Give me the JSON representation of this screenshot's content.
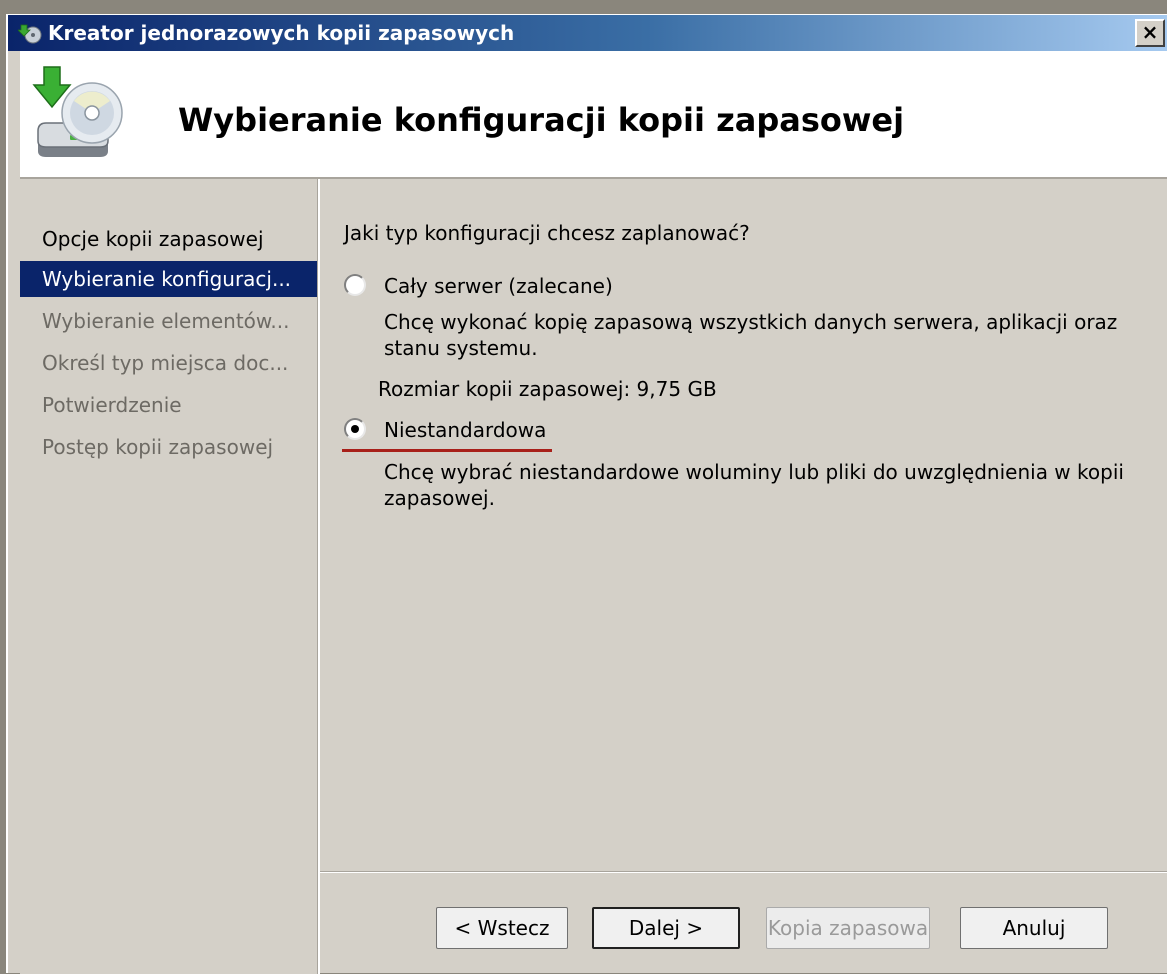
{
  "window": {
    "title": "Kreator jednorazowych kopii zapasowych",
    "close_label": "×"
  },
  "header": {
    "title": "Wybieranie konfiguracji kopii zapasowej"
  },
  "nav": {
    "items": [
      {
        "label": "Opcje kopii zapasowej",
        "state": "normal"
      },
      {
        "label": "Wybieranie konfiguracj...",
        "state": "selected"
      },
      {
        "label": "Wybieranie elementów...",
        "state": "disabled"
      },
      {
        "label": "Określ typ miejsca doc...",
        "state": "disabled"
      },
      {
        "label": "Potwierdzenie",
        "state": "disabled"
      },
      {
        "label": "Postęp kopii zapasowej",
        "state": "disabled"
      }
    ]
  },
  "main": {
    "question": "Jaki typ konfiguracji chcesz zaplanować?",
    "options": [
      {
        "label": "Cały serwer (zalecane)",
        "checked": false,
        "description": "Chcę wykonać kopię zapasową wszystkich danych serwera, aplikacji oraz stanu systemu."
      },
      {
        "label": "Niestandardowa",
        "checked": true,
        "description": "Chcę wybrać niestandardowe woluminy lub pliki do uwzględnienia w kopii zapasowej."
      }
    ],
    "backup_size": "Rozmiar kopii zapasowej: 9,75 GB"
  },
  "buttons": {
    "back": "< Wstecz",
    "next": "Dalej >",
    "backup": "Kopia zapasowa",
    "cancel": "Anuluj"
  },
  "colors": {
    "selection": "#0a246a",
    "annotation_underline": "#a8201a"
  }
}
